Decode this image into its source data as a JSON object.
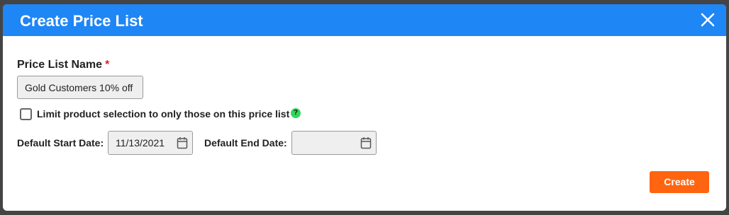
{
  "dialog": {
    "title": "Create Price List",
    "close_icon": "close-icon",
    "header_color": "#1e86f5"
  },
  "form": {
    "name_label": "Price List Name",
    "required_marker": "*",
    "name_value": "Gold Customers 10% off",
    "limit_checkbox_label": "Limit product selection to only those on this price list",
    "limit_checkbox_checked": false,
    "help_icon": "help-icon",
    "help_symbol": "?",
    "start_date_label": "Default Start Date:",
    "start_date_value": "11/13/2021",
    "end_date_label": "Default End Date:",
    "end_date_value": "",
    "calendar_icon": "calendar-icon"
  },
  "actions": {
    "create_label": "Create",
    "create_color": "#ff6410"
  }
}
